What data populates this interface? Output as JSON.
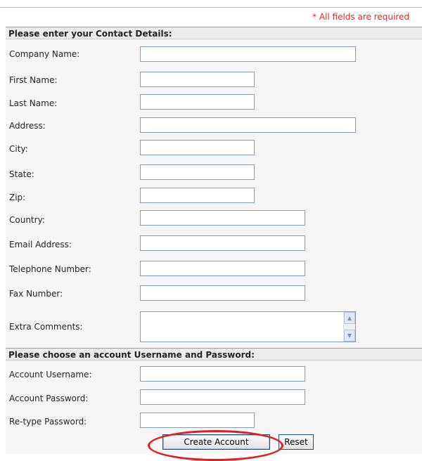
{
  "required_note": "* All fields are required",
  "contact_section": {
    "header": "Please enter your Contact Details:",
    "fields": [
      {
        "label": "Company Name:",
        "value": ""
      },
      {
        "label": "First Name:",
        "value": ""
      },
      {
        "label": "Last Name:",
        "value": ""
      },
      {
        "label": "Address:",
        "value": ""
      },
      {
        "label": "City:",
        "value": ""
      },
      {
        "label": "State:",
        "value": ""
      },
      {
        "label": "Zip:",
        "value": ""
      },
      {
        "label": "Country:",
        "value": ""
      },
      {
        "label": "Email Address:",
        "value": ""
      },
      {
        "label": "Telephone Number:",
        "value": ""
      },
      {
        "label": "Fax Number:",
        "value": ""
      },
      {
        "label": "Extra Comments:",
        "value": ""
      }
    ]
  },
  "account_section": {
    "header": "Please choose an account Username and Password:",
    "fields": [
      {
        "label": "Account Username:",
        "value": ""
      },
      {
        "label": "Account Password:",
        "value": ""
      },
      {
        "label": "Re-type Password:",
        "value": ""
      }
    ]
  },
  "buttons": {
    "create": "Create Account",
    "reset": "Reset"
  },
  "annotation": {
    "color": "#e02020"
  }
}
